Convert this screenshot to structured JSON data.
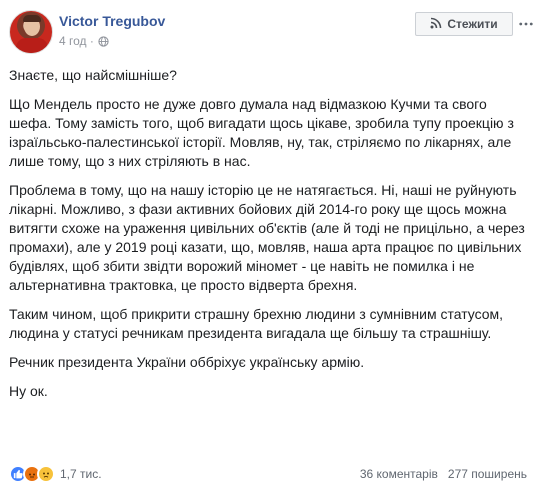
{
  "post": {
    "author": "Victor Tregubov",
    "time": "4 год ·",
    "follow_label": "Стежити",
    "paragraphs": [
      "Знаєте, що найсмішніше?",
      "Що Мендель просто не дуже довго думала над відмазкою Кучми та свого шефа. Тому замість того, щоб вигадати щось цікаве, зробила тупу проекцію з ізраїльсько-палестинської історії. Мовляв, ну, так, стріляємо по лікарнях, але лише тому, що з них стріляють в нас.",
      "Проблема в тому, що на нашу історію це не натягається. Ні, наші не руйнують лікарні. Можливо, з фази активних бойових дій 2014-го року ще щось можна витягти схоже на ураження цивільних об'єктів (але й тоді не прицільно, а через промахи), але у 2019 році казати, що, мовляв, наша арта працює по цивільних будівлях, щоб збити звідти ворожий міномет - це навіть не помилка і не альтернативна трактовка, це просто відверта брехня.",
      "Таким чином, щоб прикрити страшну брехню людини з сумнівним статусом, людина у статусі речникам президента вигадала ще більшу та страшнішу.",
      "Речник президента України оббріхує українську армію.",
      "Ну ок."
    ]
  },
  "footer": {
    "reaction_count": "1,7 тис.",
    "comments": "36 коментарів",
    "shares": "277 поширень"
  },
  "icons": {
    "like": "like-reaction-icon",
    "angry": "angry-reaction-icon",
    "sad": "sad-reaction-icon",
    "globe": "globe-icon",
    "rss": "rss-icon",
    "more": "more-icon"
  },
  "colors": {
    "author": "#385898",
    "meta": "#90949c",
    "like": "#4080ff",
    "angry": "#e9710f",
    "sad": "#f7c23a"
  }
}
